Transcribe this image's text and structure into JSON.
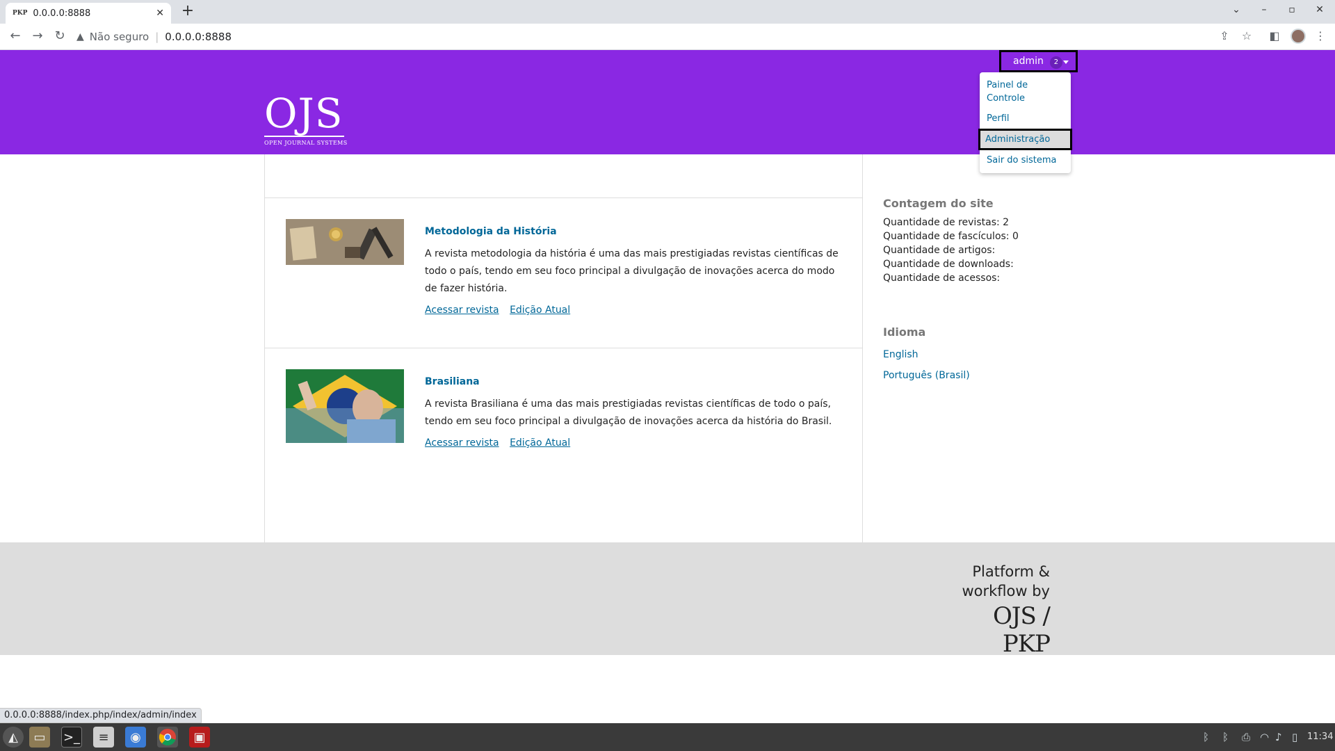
{
  "browser": {
    "tab_favicon": "PKP",
    "tab_title": "0.0.0.0:8888",
    "tab_close": "✕",
    "new_tab": "+",
    "security_label": "Não seguro",
    "url": "0.0.0.0:8888",
    "status_url": "0.0.0.0:8888/index.php/index/admin/index"
  },
  "header": {
    "logo_big": "OJS",
    "logo_small": "OPEN JOURNAL SYSTEMS",
    "user_name": "admin",
    "user_badge": "2",
    "bg_color": "#8a28e3"
  },
  "user_menu": {
    "items": [
      {
        "label": "Painel de Controle"
      },
      {
        "label": "Perfil"
      },
      {
        "label": "Administração"
      },
      {
        "label": "Sair do sistema"
      }
    ]
  },
  "journals": [
    {
      "title": "Metodologia da História",
      "description": "A revista metodologia da história é uma das mais prestigiadas revistas científicas de todo o país, tendo em seu foco principal a divulgação de inovações acerca do modo de fazer história.",
      "link_access": "Acessar revista",
      "link_current": "Edição Atual"
    },
    {
      "title": "Brasiliana",
      "description": "A revista Brasiliana é uma das mais prestigiadas revistas científicas de todo o país, tendo em seu foco principal a divulgação de inovações acerca da história do Brasil.",
      "link_access": "Acessar revista",
      "link_current": "Edição Atual"
    }
  ],
  "sidebar": {
    "stats_title": "Contagem do site",
    "stats": [
      "Quantidade de revistas: 2",
      "Quantidade de fascículos: 0",
      "Quantidade de artigos:",
      "Quantidade de downloads:",
      "Quantidade de acessos:"
    ],
    "lang_title": "Idioma",
    "languages": [
      "English",
      "Português (Brasil)"
    ]
  },
  "footer": {
    "line1": "Platform &",
    "line2": "workflow by",
    "brand": "OJS / PKP"
  },
  "taskbar": {
    "clock": "11:34"
  }
}
